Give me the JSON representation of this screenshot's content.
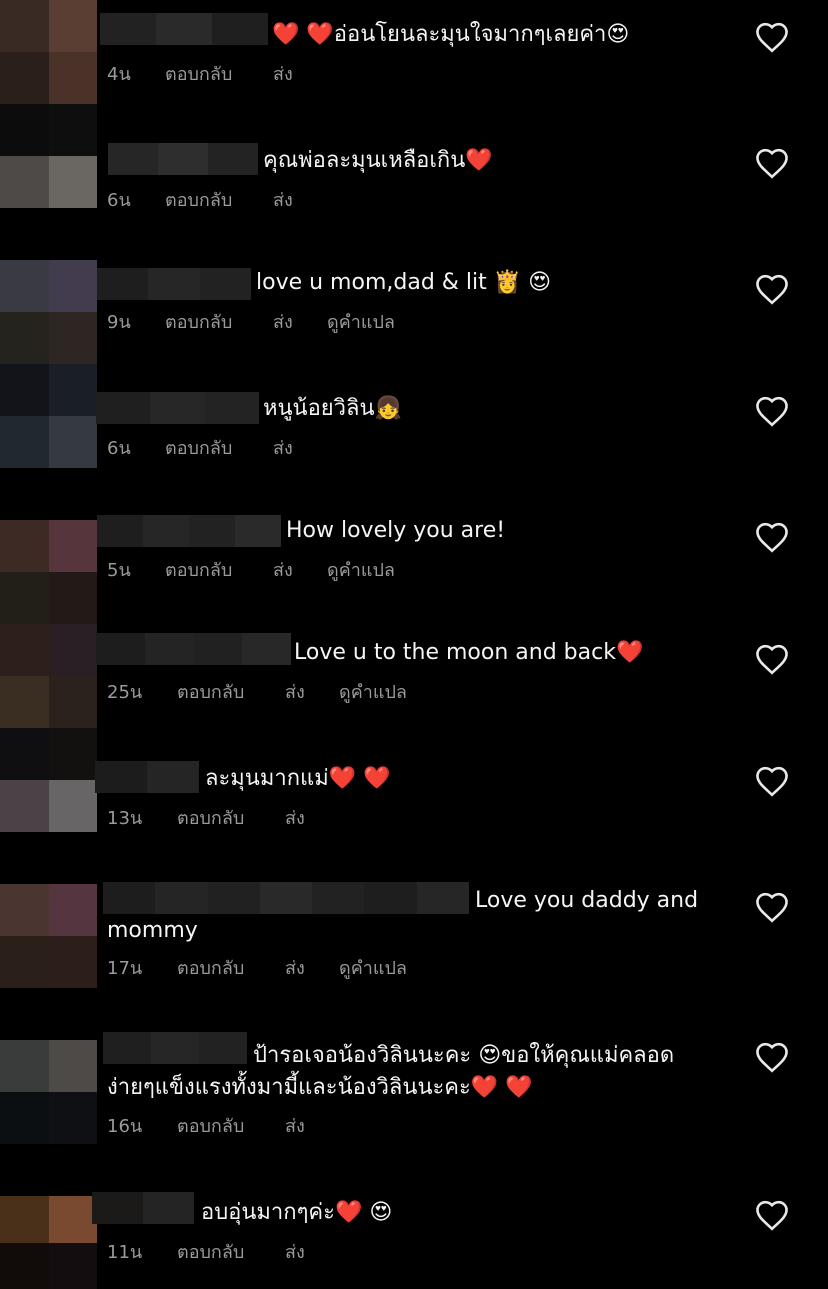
{
  "comments": [
    {
      "id": 1,
      "text": "❤️ ❤️อ่อนโยนละมุนใจมากๆเลยค่า😍",
      "time": "4น",
      "reply": "ตอบกลับ",
      "send": "ส่ง",
      "translate": ""
    },
    {
      "id": 2,
      "text": "คุณพ่อละมุนเหลือเกิน❤️",
      "time": "6น",
      "reply": "ตอบกลับ",
      "send": "ส่ง",
      "translate": ""
    },
    {
      "id": 3,
      "text": "love u mom,dad & lit 👸 😍",
      "time": "9น",
      "reply": "ตอบกลับ",
      "send": "ส่ง",
      "translate": "ดูคำแปล"
    },
    {
      "id": 4,
      "text": "หนูน้อยวิลิน👧",
      "time": "6น",
      "reply": "ตอบกลับ",
      "send": "ส่ง",
      "translate": ""
    },
    {
      "id": 5,
      "text": "How lovely you are!",
      "time": "5น",
      "reply": "ตอบกลับ",
      "send": "ส่ง",
      "translate": "ดูคำแปล"
    },
    {
      "id": 6,
      "text": "Love u to the moon and back❤️",
      "time": "25น",
      "reply": "ตอบกลับ",
      "send": "ส่ง",
      "translate": "ดูคำแปล"
    },
    {
      "id": 7,
      "text": "ละมุนมากแม่❤️ ❤️",
      "time": "13น",
      "reply": "ตอบกลับ",
      "send": "ส่ง",
      "translate": ""
    },
    {
      "id": 8,
      "text": "Love you daddy and mommy",
      "time": "17น",
      "reply": "ตอบกลับ",
      "send": "ส่ง",
      "translate": "ดูคำแปล"
    },
    {
      "id": 9,
      "text": "ป้ารอเจอน้องวิลินนะคะ 😍ขอให้คุณแม่คลอดง่ายๆแข็งแรงทั้งมามี้และน้องวิลินนะคะ❤️ ❤️",
      "time": "16น",
      "reply": "ตอบกลับ",
      "send": "ส่ง",
      "translate": ""
    },
    {
      "id": 10,
      "text": "อบอุ่นมากๆค่ะ❤️ 😍",
      "time": "11น",
      "reply": "ตอบกลับ",
      "send": "ส่ง",
      "translate": ""
    }
  ],
  "icons": {
    "like": "heart-outline-icon"
  },
  "colors": {
    "background": "#000000",
    "text": "#f5f5f5",
    "meta": "#9a9a9a"
  }
}
